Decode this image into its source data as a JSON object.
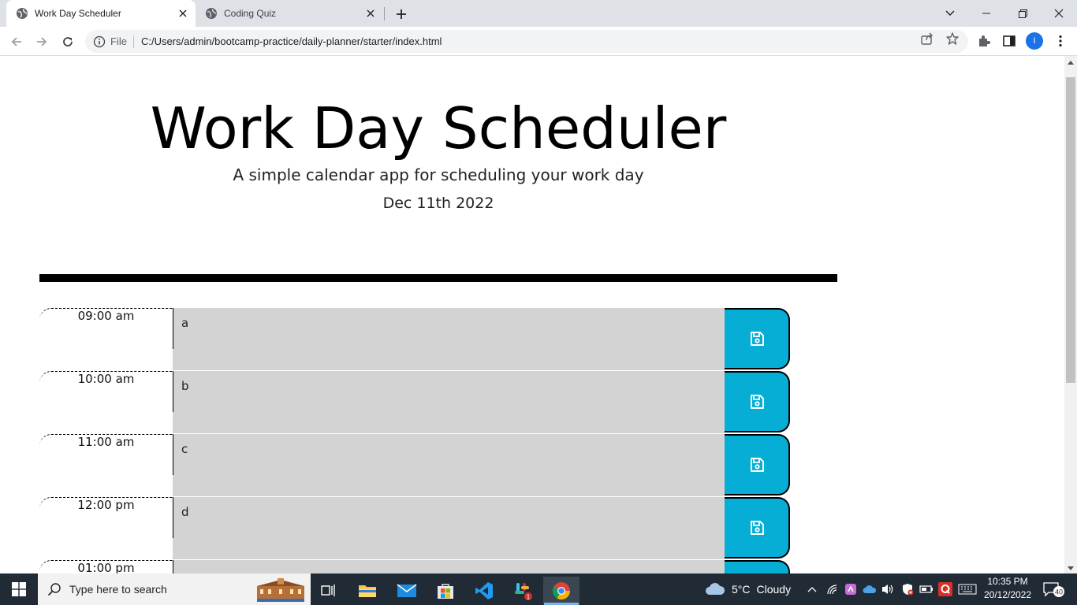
{
  "browser": {
    "tabs": [
      {
        "title": "Work Day Scheduler",
        "active": true
      },
      {
        "title": "Coding Quiz",
        "active": false
      }
    ],
    "address": {
      "scheme_label": "File",
      "url": "C:/Users/admin/bootcamp-practice/daily-planner/starter/index.html"
    },
    "profile_initial": "I"
  },
  "page": {
    "title": "Work Day Scheduler",
    "lead": "A simple calendar app for scheduling your work day",
    "current_day": "Dec 11th 2022",
    "time_blocks": [
      {
        "hour": "09:00 am",
        "text": "a"
      },
      {
        "hour": "10:00 am",
        "text": "b"
      },
      {
        "hour": "11:00 am",
        "text": "c"
      },
      {
        "hour": "12:00 pm",
        "text": "d"
      },
      {
        "hour": "01:00 pm",
        "text": ""
      }
    ],
    "colors": {
      "block_past": "#d3d3d3",
      "save_button": "#06aed5"
    }
  },
  "taskbar": {
    "search_placeholder": "Type here to search",
    "weather": {
      "temp": "5°C",
      "condition": "Cloudy"
    },
    "clock": {
      "time": "10:35 PM",
      "date": "20/12/2022"
    },
    "notifications_count": "40",
    "chrome_badge": "1"
  }
}
